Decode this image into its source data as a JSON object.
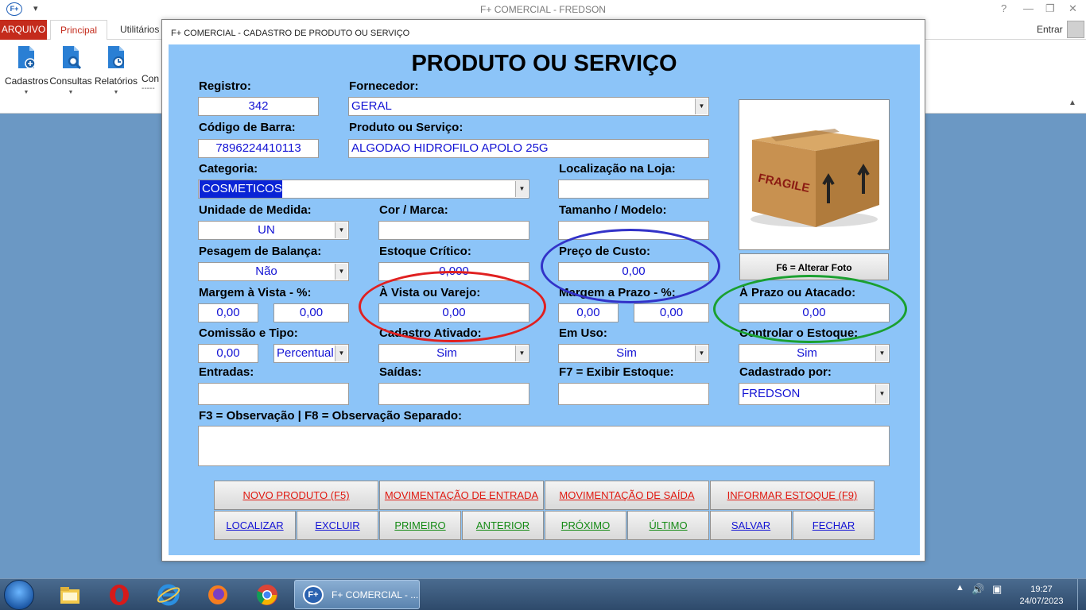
{
  "app": {
    "title": "F+ COMERCIAL - FREDSON",
    "logo_text": "F+",
    "win_controls": [
      "?",
      "—",
      "❐",
      "✕"
    ]
  },
  "ribbon": {
    "tabs": [
      "ARQUIVO",
      "Principal",
      "Utilitários"
    ],
    "entrar": "Entrar",
    "buttons": [
      "Cadastros",
      "Consultas",
      "Relatórios",
      "Con"
    ],
    "trailing": "-----"
  },
  "dialog": {
    "title": "F+ COMERCIAL - CADASTRO DE PRODUTO OU SERVIÇO",
    "heading": "PRODUTO OU SERVIÇO",
    "labels": {
      "registro": "Registro:",
      "fornecedor": "Fornecedor:",
      "codigo_barra": "Código de Barra:",
      "produto_servico": "Produto ou Serviço:",
      "categoria": "Categoria:",
      "localizacao": "Localização na Loja:",
      "unidade": "Unidade de Medida:",
      "cor_marca": "Cor / Marca:",
      "tamanho": "Tamanho / Modelo:",
      "pesagem": "Pesagem de Balança:",
      "estoque_critico": "Estoque Crítico:",
      "preco_custo": "Preço de Custo:",
      "margem_vista": "Margem à Vista - %:",
      "a_vista": "À Vista ou Varejo:",
      "margem_prazo": "Margem a Prazo - %:",
      "a_prazo": "À Prazo ou Atacado:",
      "comissao": "Comissão e Tipo:",
      "cadastro_ativado": "Cadastro Ativado:",
      "em_uso": "Em Uso:",
      "controlar_estoque": "Controlar o Estoque:",
      "entradas": "Entradas:",
      "saidas": "Saídas:",
      "exibir_estoque": "F7 = Exibir Estoque:",
      "cadastrado_por": "Cadastrado por:",
      "observacao": "F3 = Observação | F8 = Observação Separado:"
    },
    "values": {
      "registro": "342",
      "fornecedor": "GERAL",
      "codigo_barra": "7896224410113",
      "produto_servico": "ALGODAO HIDROFILO APOLO 25G",
      "categoria": "COSMETICOS",
      "localizacao": "",
      "unidade": "UN",
      "cor_marca": "",
      "tamanho": "",
      "pesagem": "Não",
      "estoque_critico": "0,000",
      "preco_custo": "0,00",
      "margem_vista_1": "0,00",
      "margem_vista_2": "0,00",
      "a_vista": "0,00",
      "margem_prazo_1": "0,00",
      "margem_prazo_2": "0,00",
      "a_prazo": "0,00",
      "comissao": "0,00",
      "comissao_tipo": "Percentual",
      "cadastro_ativado": "Sim",
      "em_uso": "Sim",
      "controlar_estoque": "Sim",
      "entradas": "",
      "saidas": "",
      "exibir_estoque": "",
      "cadastrado_por": "FREDSON"
    },
    "photo_button": "F6 = Alterar Foto",
    "photo_label": "FRAGILE",
    "buttons_row1": [
      "NOVO PRODUTO (F5)",
      "MOVIMENTAÇÃO DE ENTRADA",
      "MOVIMENTAÇÃO DE SAÍDA",
      "INFORMAR ESTOQUE (F9)"
    ],
    "buttons_row2": [
      "LOCALIZAR",
      "EXCLUIR",
      "PRIMEIRO",
      "ANTERIOR",
      "PRÓXIMO",
      "ÚLTIMO",
      "SALVAR",
      "FECHAR"
    ]
  },
  "annotations": {
    "blue_ring_color": "#3232c8",
    "red_ring_color": "#e02020",
    "green_ring_color": "#1aa030"
  },
  "taskbar": {
    "task_label": "F+ COMERCIAL - ...",
    "time": "19:27",
    "date": "24/07/2023"
  }
}
